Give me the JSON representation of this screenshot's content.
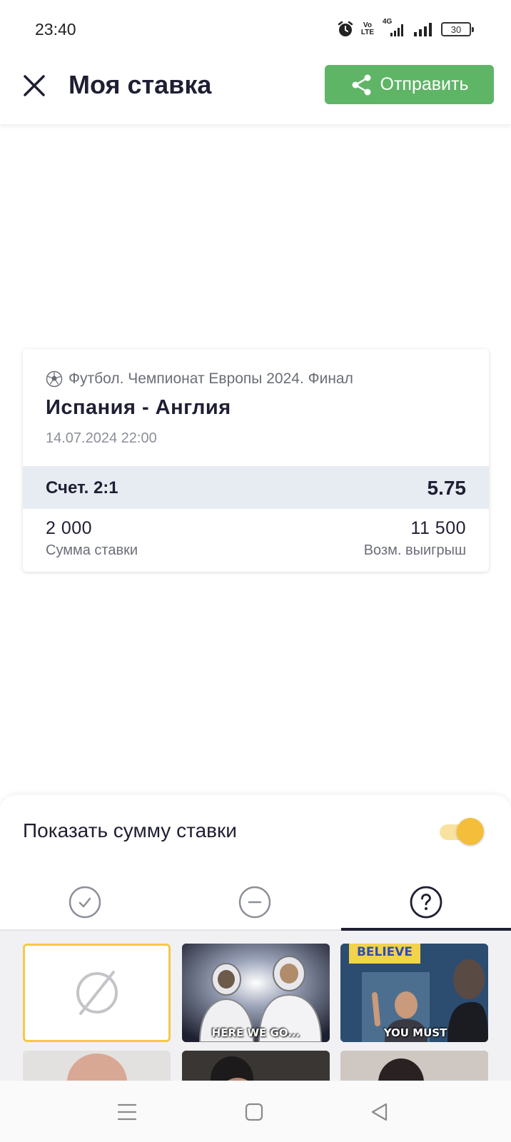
{
  "status_bar": {
    "time": "23:40",
    "volte_top": "Vo",
    "volte_bottom": "LTE",
    "network": "4G",
    "battery": "30",
    "icons": [
      "alarm-icon",
      "volte-icon",
      "signal-4g-icon",
      "signal-icon",
      "battery-icon"
    ]
  },
  "header": {
    "title": "Моя ставка",
    "send_label": "Отправить",
    "close_icon": "close-icon",
    "share_icon": "share-icon",
    "send_color": "#5fb566"
  },
  "bet": {
    "event": "Футбол. Чемпионат Европы 2024. Финал",
    "sport_icon": "soccer-ball-icon",
    "match": "Испания - Англия",
    "datetime": "14.07.2024 22:00",
    "outcome": "Счет. 2:1",
    "odds": "5.75",
    "stake": "2 000",
    "stake_label": "Сумма ставки",
    "potential_win": "11 500",
    "potential_win_label": "Возм. выигрыш"
  },
  "sheet": {
    "toggle_label": "Показать сумму ставки",
    "toggle_on": true,
    "accent_color": "#f5be3a",
    "tabs": [
      {
        "icon": "check-circle-icon",
        "active": false
      },
      {
        "icon": "minus-circle-icon",
        "active": false
      },
      {
        "icon": "question-circle-icon",
        "active": true
      }
    ],
    "gifs": [
      {
        "icon": "no-gif-icon",
        "caption": "",
        "selected": true
      },
      {
        "icon": "gif-astronauts",
        "caption": "HERE WE GO...",
        "selected": false
      },
      {
        "icon": "gif-believe",
        "caption": "YOU MUST",
        "selected": false,
        "sign": "BELIEVE"
      }
    ]
  },
  "nav": {
    "icons": [
      "menu-icon",
      "home-square-icon",
      "back-triangle-icon"
    ]
  }
}
